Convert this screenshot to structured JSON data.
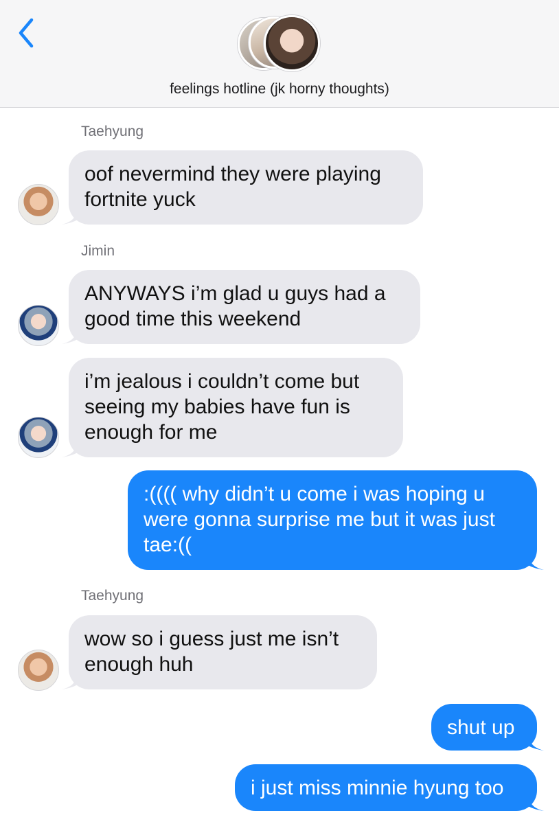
{
  "header": {
    "title": "feelings hotline (jk horny thoughts)",
    "back_icon": "chevron-left-icon",
    "accent_color": "#1a86fb"
  },
  "messages": [
    {
      "sender": "Taehyung",
      "direction": "incoming",
      "text": "oof nevermind they were playing\nfortnite yuck"
    },
    {
      "sender": "Jimin",
      "direction": "incoming",
      "text": "ANYWAYS i’m glad u guys had a\ngood time this weekend"
    },
    {
      "sender": "Jimin",
      "direction": "incoming",
      "text": "i’m jealous i couldn’t come but\nseeing my babies have fun is\nenough for me"
    },
    {
      "direction": "outgoing",
      "text": ":(((( why didn’t u come i was hoping u\nwere gonna surprise me but it was just\ntae:(("
    },
    {
      "sender": "Taehyung",
      "direction": "incoming",
      "text": "wow so i guess just me isn’t\nenough huh"
    },
    {
      "direction": "outgoing",
      "text": "shut up"
    },
    {
      "direction": "outgoing",
      "text": "i just miss minnie hyung too"
    }
  ],
  "colors": {
    "incoming_bubble": "#e8e8ed",
    "outgoing_bubble": "#1a86fb",
    "header_bg": "#f6f6f7"
  }
}
